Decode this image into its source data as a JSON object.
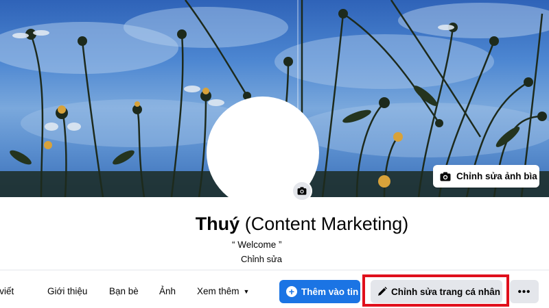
{
  "cover": {
    "edit_cover_label": "Chỉnh sửa ảnh bìa"
  },
  "profile": {
    "name": "Thuý",
    "role": "(Content Marketing)",
    "bio": "“ Welcome ”",
    "bio_edit_label": "Chỉnh sửa"
  },
  "tabs": [
    {
      "label": "Bài viết"
    },
    {
      "label": "Giới thiệu"
    },
    {
      "label": "Bạn bè"
    },
    {
      "label": "Ảnh"
    },
    {
      "label": "Xem thêm"
    }
  ],
  "actions": {
    "add_story_label": "Thêm vào tin",
    "edit_profile_label": "Chỉnh sửa trang cá nhân",
    "more_label": "•••"
  },
  "colors": {
    "primary": "#1b74e4",
    "highlight": "#e0101c",
    "button_gray": "#e4e6eb"
  },
  "icons": {
    "camera": "camera-icon",
    "pencil": "pencil-icon",
    "plus": "plus-icon",
    "chevron": "chevron-down-icon",
    "more": "more-icon"
  }
}
